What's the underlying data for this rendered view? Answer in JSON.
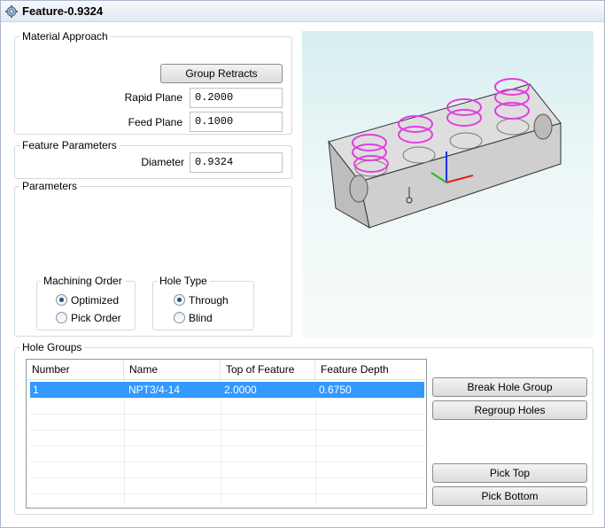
{
  "window": {
    "title": "Feature-0.9324",
    "icon": "gear-icon"
  },
  "material_approach": {
    "label": "Material Approach",
    "group_retracts": "Group Retracts",
    "rapid_plane_label": "Rapid Plane",
    "rapid_plane_value": "0.2000",
    "feed_plane_label": "Feed Plane",
    "feed_plane_value": "0.1000"
  },
  "feature_parameters": {
    "label": "Feature Parameters",
    "diameter_label": "Diameter",
    "diameter_value": "0.9324"
  },
  "parameters": {
    "label": "Parameters",
    "machining_order": {
      "label": "Machining Order",
      "options": [
        "Optimized",
        "Pick Order"
      ],
      "selected": "Optimized"
    },
    "hole_type": {
      "label": "Hole Type",
      "options": [
        "Through",
        "Blind"
      ],
      "selected": "Through"
    }
  },
  "hole_groups": {
    "label": "Hole Groups",
    "columns": [
      "Number",
      "Name",
      "Top of Feature",
      "Feature Depth"
    ],
    "rows": [
      [
        "1",
        "NPT3/4-14",
        "2.0000",
        "0.6750"
      ]
    ],
    "selected_row": 0,
    "buttons": {
      "break": "Break Hole Group",
      "regroup": "Regroup Holes",
      "pick_top": "Pick Top",
      "pick_bottom": "Pick Bottom"
    }
  },
  "colors": {
    "selection": "#3399ff",
    "hole_highlight": "#e040e0",
    "axis_x": "#e02020",
    "axis_y": "#20c020",
    "axis_z": "#2030e0"
  }
}
